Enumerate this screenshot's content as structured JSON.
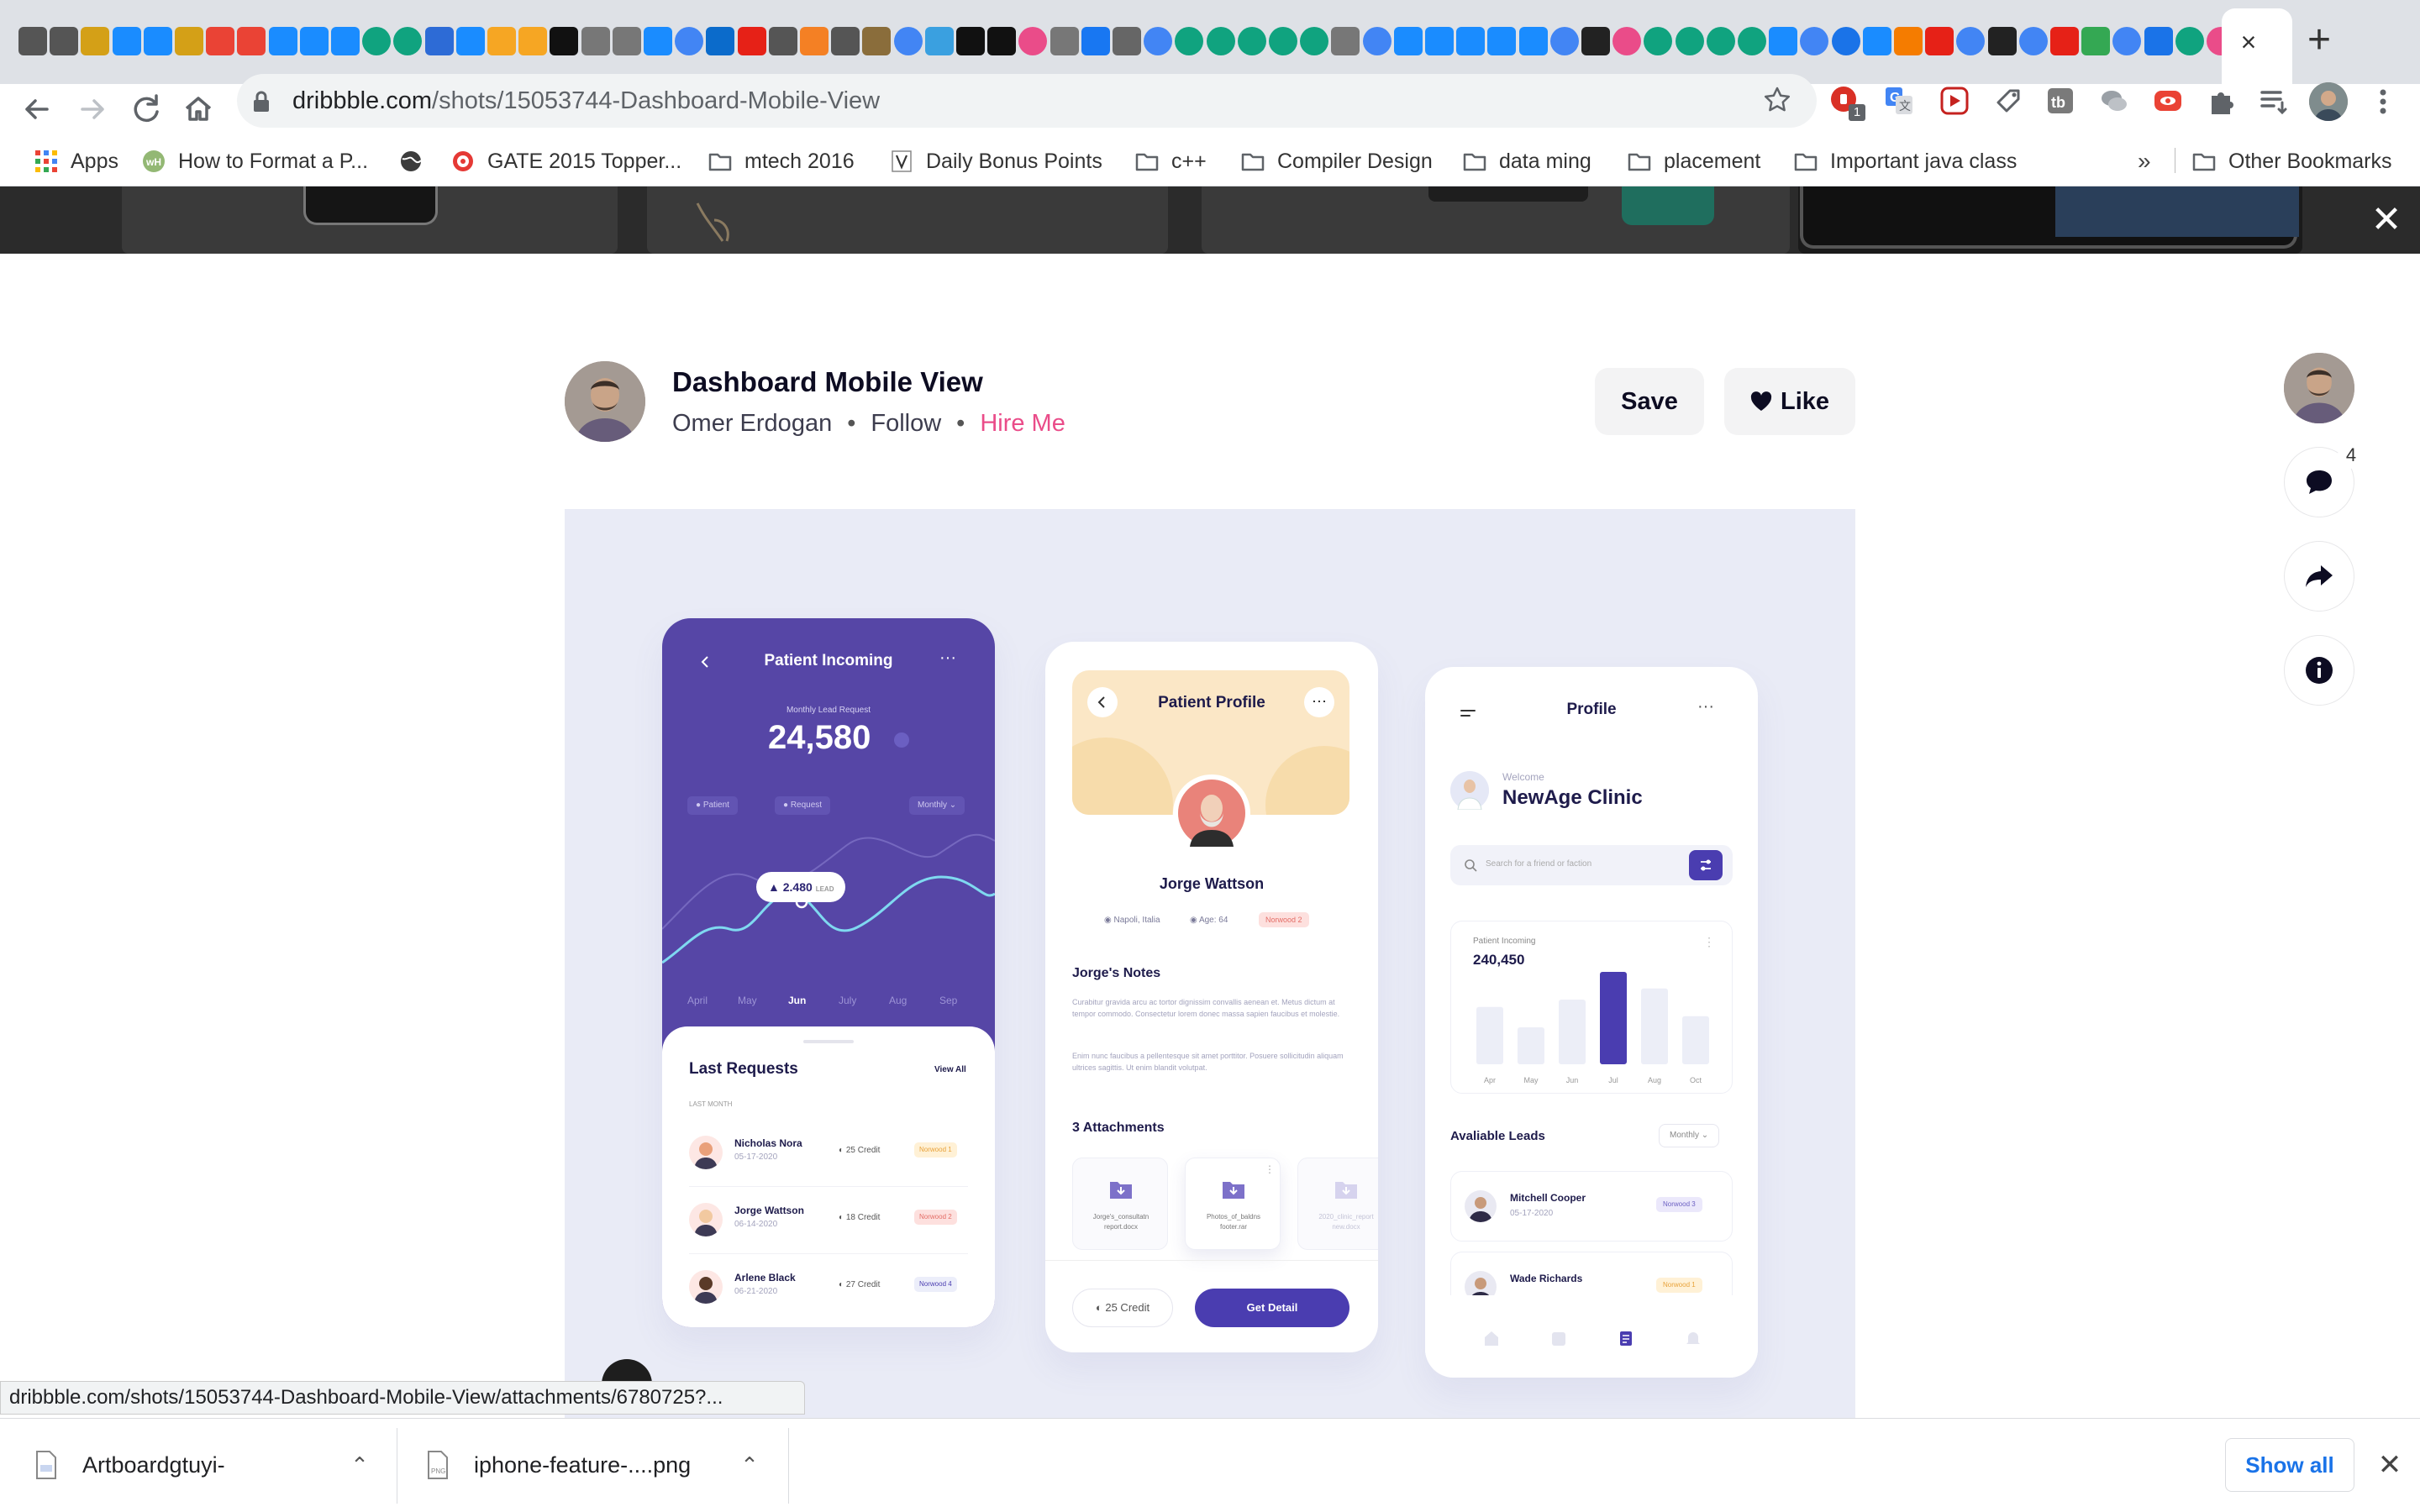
{
  "browser": {
    "tab_favicons": [
      "apple",
      "apple",
      "app",
      "appstore",
      "appstore",
      "app",
      "gmail",
      "gmail",
      "appstore",
      "appstore",
      "appstore",
      "openai",
      "openai",
      "m",
      "appstore",
      "firebase",
      "firebase",
      "notion",
      "inspect",
      "inspect",
      "appstore",
      "google",
      "cs",
      "youtube",
      "apple",
      "stack",
      "apple",
      "cat",
      "google",
      "arrow",
      "notion",
      "notion",
      "dribbble",
      "inspect",
      "facebook",
      "photo",
      "google",
      "openai",
      "openai",
      "openai",
      "openai",
      "openai",
      "inspect",
      "google",
      "appstore",
      "appstore",
      "appstore",
      "appstore",
      "appstore",
      "google",
      "swift",
      "dribbble",
      "openai",
      "openai",
      "openai",
      "openai",
      "appstore",
      "google",
      "clock",
      "appstore",
      "rings",
      "youtube",
      "google",
      "amazon",
      "google",
      "youtube",
      "check",
      "google",
      "diamond",
      "openai",
      "dribbble"
    ],
    "url_domain": "dribbble.com",
    "url_path": "/shots/15053744-Dashboard-Mobile-View",
    "extension_badge": "1"
  },
  "bookmarks": {
    "items": [
      {
        "label": "Apps",
        "icon": "apps-grid-icon"
      },
      {
        "label": "How to Format a P...",
        "icon": "wikihow-icon"
      },
      {
        "label": "",
        "icon": "globe-icon"
      },
      {
        "label": "GATE 2015 Topper...",
        "icon": "target-icon"
      },
      {
        "label": "mtech 2016",
        "icon": "folder-icon"
      },
      {
        "label": "Daily Bonus Points",
        "icon": "v-icon"
      },
      {
        "label": "c++",
        "icon": "folder-icon"
      },
      {
        "label": "Compiler Design",
        "icon": "folder-icon"
      },
      {
        "label": "data ming",
        "icon": "folder-icon"
      },
      {
        "label": "placement",
        "icon": "folder-icon"
      },
      {
        "label": "Important java class",
        "icon": "folder-icon"
      }
    ],
    "overflow": "»",
    "other": "Other Bookmarks"
  },
  "shot": {
    "title": "Dashboard Mobile View",
    "author": "Omer Erdogan",
    "follow": "Follow",
    "hire": "Hire Me",
    "save": "Save",
    "like": "Like",
    "comment_count": "4"
  },
  "phone1": {
    "title": "Patient Incoming",
    "subtitle": "Monthly Lead Request",
    "big_value": "24,580",
    "legend": [
      "Patient",
      "Request"
    ],
    "period": "Monthly",
    "tooltip_value": "2.480",
    "tooltip_unit": "LEAD",
    "months": [
      "April",
      "May",
      "Jun",
      "July",
      "Aug",
      "Sep"
    ],
    "requests_title": "Last Requests",
    "view_all": "View All",
    "section": "LAST MONTH",
    "requests": [
      {
        "name": "Nicholas Nora",
        "date": "05-17-2020",
        "credit": "25 Credit",
        "tag": "Norwood 1"
      },
      {
        "name": "Jorge Wattson",
        "date": "06-14-2020",
        "credit": "18 Credit",
        "tag": "Norwood 2"
      },
      {
        "name": "Arlene Black",
        "date": "06-21-2020",
        "credit": "27 Credit",
        "tag": "Norwood 4"
      }
    ]
  },
  "phone2": {
    "title": "Patient Profile",
    "name": "Jorge Wattson",
    "location": "Napoli, Italia",
    "age": "Age: 64",
    "tag": "Norwood 2",
    "notes_title": "Jorge's Notes",
    "notes_1": "Curabitur gravida arcu ac tortor dignissim convallis aenean et. Metus dictum at tempor commodo. Consectetur lorem donec massa sapien faucibus et molestie.",
    "notes_2": "Enim nunc faucibus a pellentesque sit amet porttitor. Posuere sollicitudin aliquam ultrices sagittis. Ut enim blandit volutpat.",
    "attachments_title": "3 Attachments",
    "attachments": [
      "Jorge's_consultatn report.docx",
      "Photos_of_baldns footer.rar",
      "2020_clinic_report new.docx"
    ],
    "credit": "25 Credit",
    "cta": "Get Detail"
  },
  "phone3": {
    "title": "Profile",
    "welcome": "Welcome",
    "clinic": "NewAge Clinic",
    "search_placeholder": "Search for a friend or faction",
    "card_title": "Patient Incoming",
    "card_value": "240,450",
    "leads_title": "Avaliable Leads",
    "leads_period": "Monthly",
    "leads": [
      {
        "name": "Mitchell Cooper",
        "date": "05-17-2020",
        "tag": "Norwood 3"
      },
      {
        "name": "Wade Richards",
        "date": "",
        "tag": "Norwood 1"
      }
    ]
  },
  "chart_data": {
    "type": "bar",
    "categories": [
      "Apr",
      "May",
      "Jun",
      "Jul",
      "Aug",
      "Oct"
    ],
    "values": [
      62,
      40,
      70,
      100,
      82,
      52
    ],
    "highlight": "Jul"
  },
  "status_url": "dribbble.com/shots/15053744-Dashboard-Mobile-View/attachments/6780725?...",
  "downloads": {
    "items": [
      "Artboardgtuyi-",
      "iphone-feature-....png"
    ],
    "show_all": "Show all"
  },
  "colors": {
    "accent": "#4a3db0",
    "dribbble_pink": "#ea4c89",
    "shot_bg": "#e9ebf6"
  }
}
